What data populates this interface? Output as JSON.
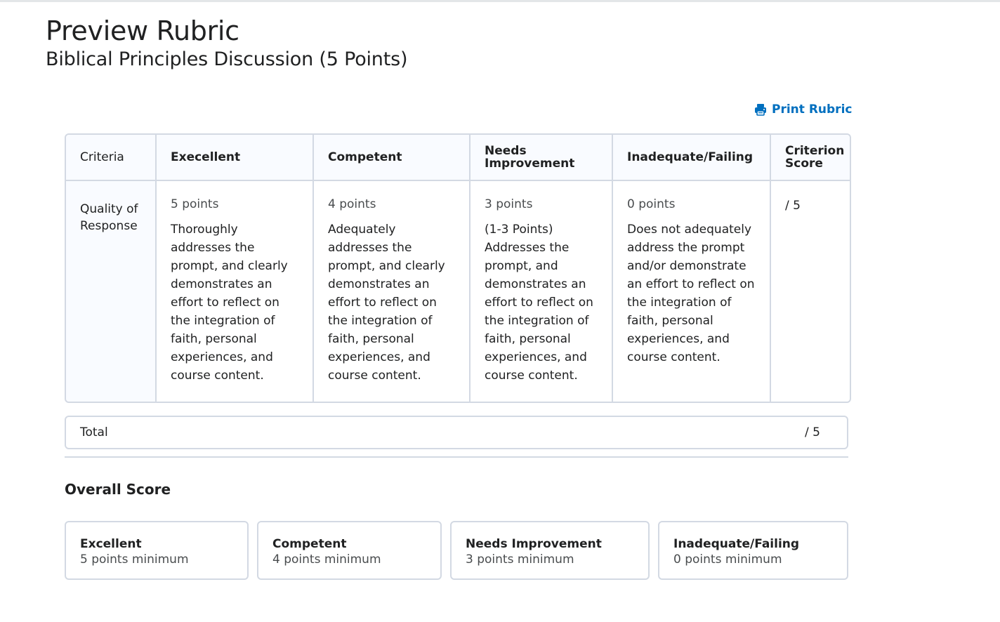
{
  "header": {
    "title": "Preview Rubric",
    "subtitle": "Biblical Principles Discussion (5 Points)"
  },
  "toolbar": {
    "print_label": "Print Rubric",
    "print_icon": "printer-icon",
    "accent_color": "#006fbf"
  },
  "rubric": {
    "columns": [
      "Criteria",
      "Execellent",
      "Competent",
      "Needs Improvement",
      "Inadequate/Failing",
      "Criterion Score"
    ],
    "rows": [
      {
        "criterion": "Quality of Response",
        "levels": [
          {
            "points": "5 points",
            "description": "Thoroughly addresses the prompt, and clearly demonstrates an effort to reflect on the integration of faith, personal experiences, and course content."
          },
          {
            "points": "4 points",
            "description": "Adequately addresses the prompt, and clearly demonstrates an effort to reflect on the integration of faith, personal experiences, and course content."
          },
          {
            "points": "3 points",
            "description_line1": "(1-3 Points)",
            "description": "Addresses the prompt, and demonstrates an effort to reflect on the integration of faith, personal experiences, and course content."
          },
          {
            "points": "0 points",
            "description": "Does not adequately address the prompt and/or demonstrate an effort to reflect on the integration of faith, personal experiences, and course content."
          }
        ],
        "score": "/ 5"
      }
    ],
    "total_label": "Total",
    "total_score": "/ 5"
  },
  "overall": {
    "heading": "Overall Score",
    "levels": [
      {
        "name": "Excellent",
        "minimum": "5 points minimum"
      },
      {
        "name": "Competent",
        "minimum": "4 points minimum"
      },
      {
        "name": "Needs Improvement",
        "minimum": "3 points minimum"
      },
      {
        "name": "Inadequate/Failing",
        "minimum": "0 points minimum"
      }
    ]
  },
  "colors": {
    "border": "#d3d9e3",
    "header_bg": "#f9fbff",
    "text": "#202122",
    "muted": "#494c4e"
  }
}
